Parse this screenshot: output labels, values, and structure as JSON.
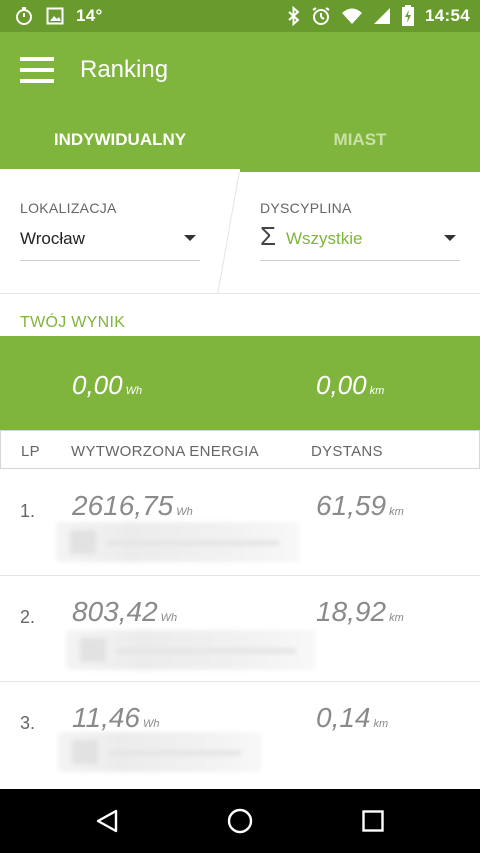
{
  "status_bar": {
    "temperature": "14°",
    "time": "14:54",
    "icons": [
      "stopwatch-icon",
      "image-icon",
      "bluetooth-icon",
      "alarm-icon",
      "wifi-icon",
      "signal-icon",
      "battery-charging-icon"
    ]
  },
  "app_bar": {
    "title": "Ranking",
    "menu_icon": "hamburger-menu-icon"
  },
  "tabs": [
    {
      "label": "INDYWIDUALNY",
      "active": true
    },
    {
      "label": "MIAST",
      "active": false
    }
  ],
  "filters": {
    "location": {
      "label": "LOKALIZACJA",
      "value": "Wrocław"
    },
    "discipline": {
      "label": "DYSCYPLINA",
      "value": "Wszystkie",
      "icon": "sigma-icon"
    }
  },
  "my_result": {
    "label": "TWÓJ WYNIK",
    "energy": "0,00",
    "energy_unit": "Wh",
    "distance": "0,00",
    "distance_unit": "km"
  },
  "table": {
    "headers": {
      "rank": "LP",
      "energy": "WYTWORZONA ENERGIA",
      "distance": "DYSTANS"
    },
    "rows": [
      {
        "rank": "1.",
        "energy": "2616,75",
        "energy_unit": "Wh",
        "distance": "61,59",
        "distance_unit": "km"
      },
      {
        "rank": "2.",
        "energy": "803,42",
        "energy_unit": "Wh",
        "distance": "18,92",
        "distance_unit": "km"
      },
      {
        "rank": "3.",
        "energy": "11,46",
        "energy_unit": "Wh",
        "distance": "0,14",
        "distance_unit": "km"
      }
    ]
  },
  "nav_bar": {
    "icons": [
      "back-triangle-icon",
      "home-circle-icon",
      "recents-square-icon"
    ]
  },
  "colors": {
    "accent": "#80b53d",
    "status_bar": "#689a2e",
    "value_gray": "#8a8a8a"
  }
}
